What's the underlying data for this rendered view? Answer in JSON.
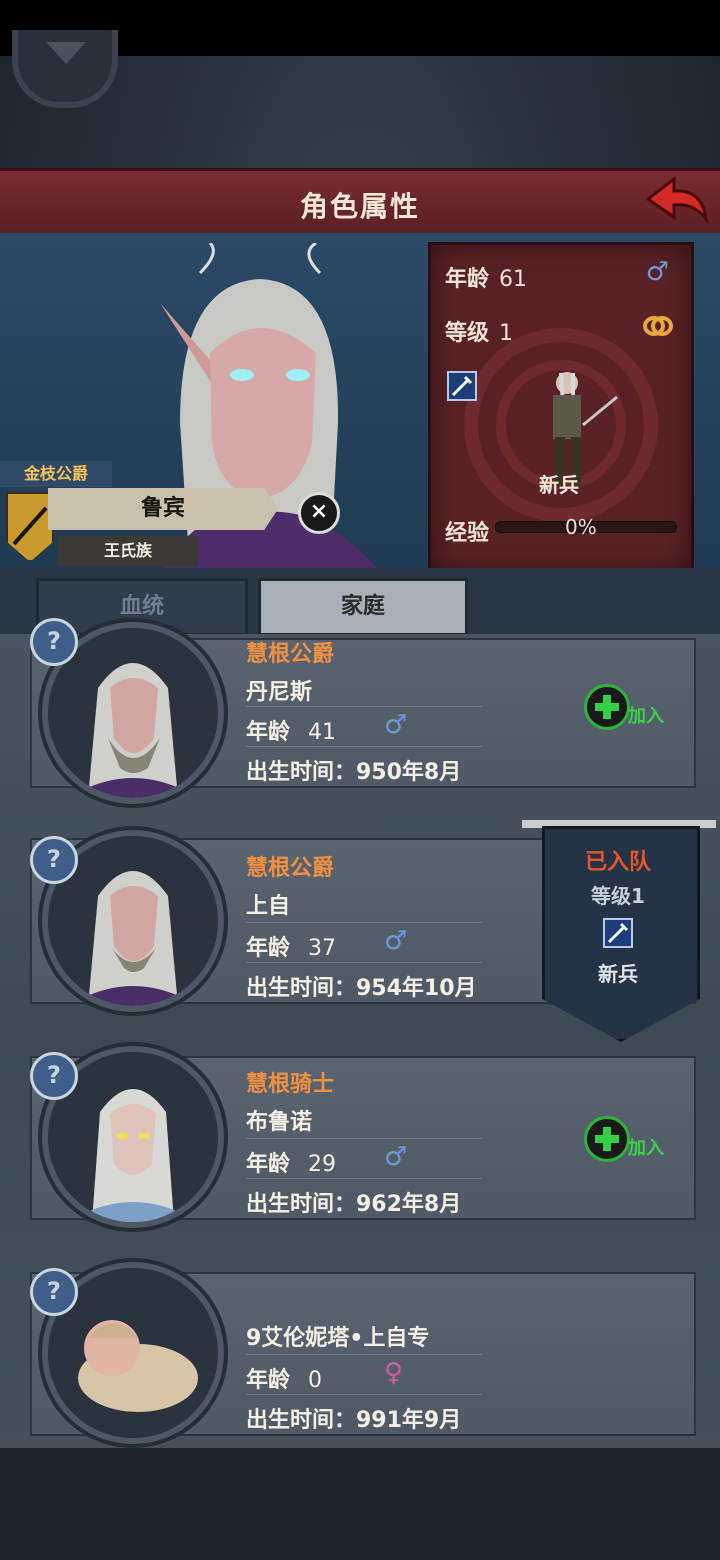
{
  "header": {
    "title": "角色属性"
  },
  "hero": {
    "title_tag": "金枝公爵",
    "name": "鲁宾",
    "clan": "王氏族",
    "age_label": "年龄",
    "age": "61",
    "level_label": "等级",
    "level": "1",
    "rank": "新兵",
    "exp_label": "经验",
    "exp_percent": "0%",
    "exp_fraction": 0.0,
    "gender": "male"
  },
  "tabs": [
    {
      "label": "血统",
      "active": false
    },
    {
      "label": "家庭",
      "active": true
    }
  ],
  "members": [
    {
      "title": "慧根公爵",
      "name": "丹尼斯",
      "age_label": "年龄",
      "age": "41",
      "gender": "male",
      "birth": "出生时间：950年8月",
      "action": "加入"
    },
    {
      "title": "慧根公爵",
      "name": "上自",
      "age_label": "年龄",
      "age": "37",
      "gender": "male",
      "birth": "出生时间：954年10月",
      "action": ""
    },
    {
      "title": "慧根骑士",
      "name": "布鲁诺",
      "age_label": "年龄",
      "age": "29",
      "gender": "male",
      "birth": "出生时间：962年8月",
      "action": "加入"
    },
    {
      "title": "",
      "name": "9艾伦妮塔•上自专",
      "age_label": "年龄",
      "age": "0",
      "gender": "female",
      "birth": "出生时间：991年9月",
      "action": ""
    }
  ],
  "joined_banner": {
    "status": "已入队",
    "level": "等级1",
    "rank": "新兵"
  },
  "colors": {
    "title_bar": "#7a2e33",
    "panel": "#5a2226",
    "accent_orange": "#f09040",
    "add_green": "#34d044",
    "male_blue": "#6a9ad8",
    "female_pink": "#d05aa0"
  }
}
